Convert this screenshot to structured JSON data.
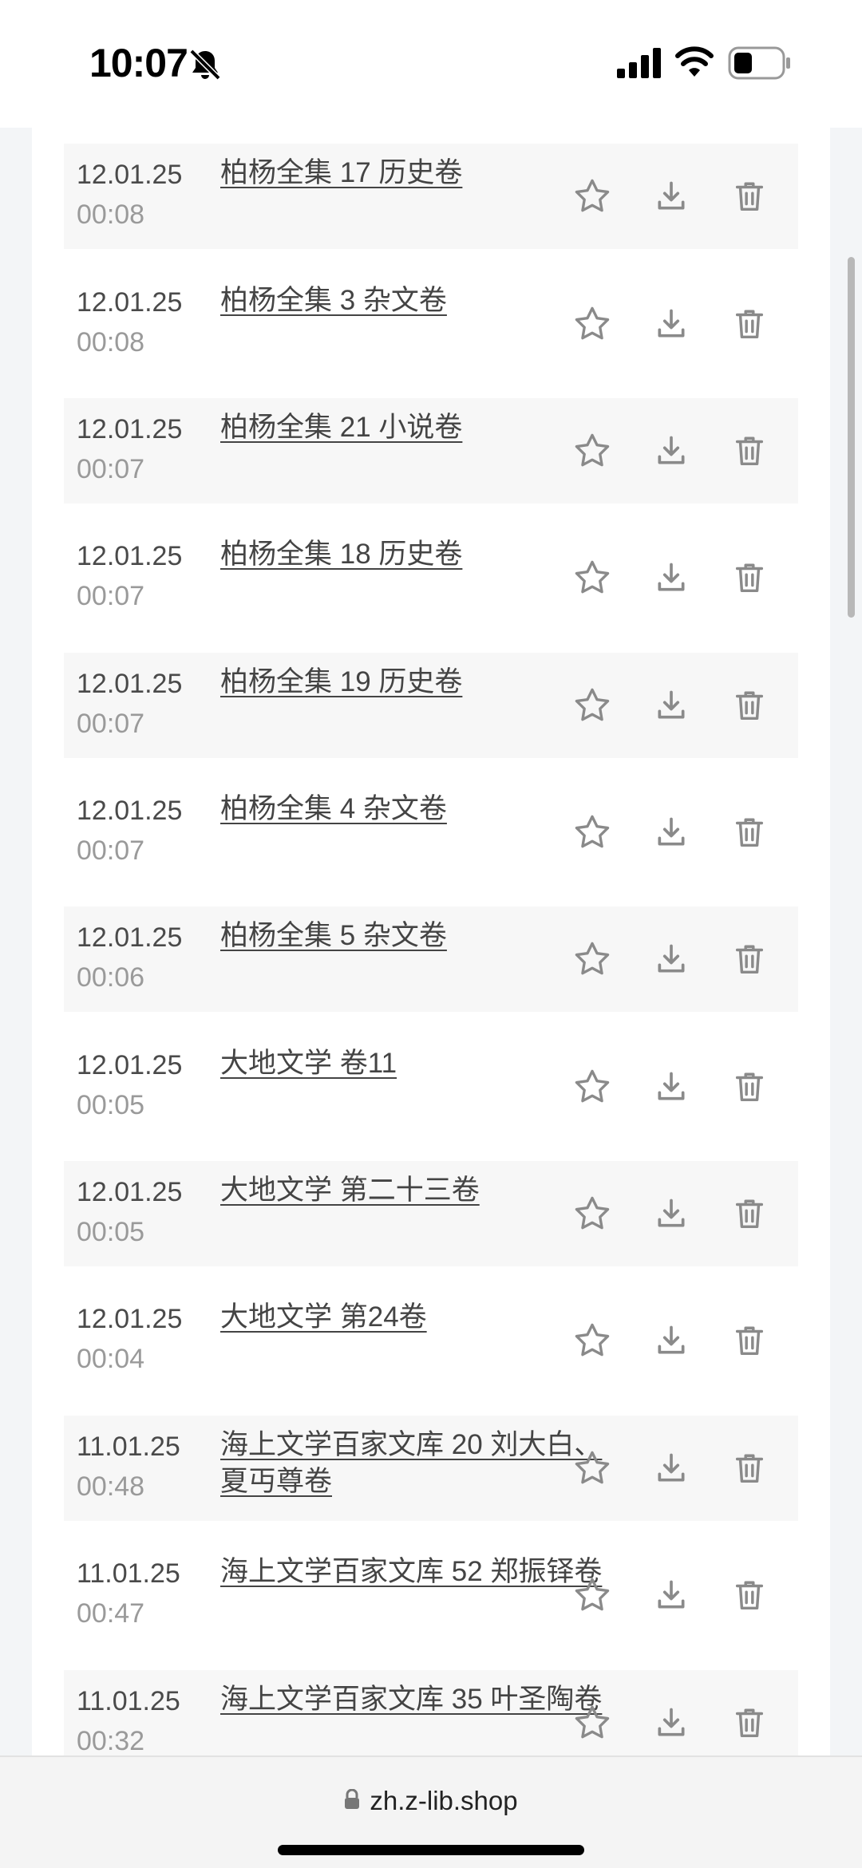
{
  "status_bar": {
    "time": "10:07",
    "icons": [
      "bell-slash-icon",
      "cellular-signal-icon",
      "wifi-icon",
      "battery-icon"
    ]
  },
  "rows": [
    {
      "date": "12.01.25",
      "time": "00:08",
      "title": "柏杨全集 17 历史卷"
    },
    {
      "date": "12.01.25",
      "time": "00:08",
      "title": "柏杨全集 3 杂文卷"
    },
    {
      "date": "12.01.25",
      "time": "00:07",
      "title": "柏杨全集 21 小说卷"
    },
    {
      "date": "12.01.25",
      "time": "00:07",
      "title": "柏杨全集 18 历史卷"
    },
    {
      "date": "12.01.25",
      "time": "00:07",
      "title": "柏杨全集 19 历史卷"
    },
    {
      "date": "12.01.25",
      "time": "00:07",
      "title": "柏杨全集 4 杂文卷"
    },
    {
      "date": "12.01.25",
      "time": "00:06",
      "title": "柏杨全集 5 杂文卷"
    },
    {
      "date": "12.01.25",
      "time": "00:05",
      "title": "大地文学 卷11"
    },
    {
      "date": "12.01.25",
      "time": "00:05",
      "title": "大地文学 第二十三卷"
    },
    {
      "date": "12.01.25",
      "time": "00:04",
      "title": "大地文学 第24卷"
    },
    {
      "date": "11.01.25",
      "time": "00:48",
      "title": "海上文学百家文库 20 刘大白、夏丏尊卷"
    },
    {
      "date": "11.01.25",
      "time": "00:47",
      "title": "海上文学百家文库 52 郑振铎卷"
    },
    {
      "date": "11.01.25",
      "time": "00:32",
      "title": "海上文学百家文库 35 叶圣陶卷"
    }
  ],
  "row_actions": [
    "star-icon",
    "download-icon",
    "trash-icon"
  ],
  "url_bar": {
    "url": "zh.z-lib.shop",
    "icon": "lock-icon"
  },
  "colors": {
    "icon_gray": "#8a8a8a",
    "row_shade": "#f7f7f7",
    "page_bg": "#f3f5f7"
  }
}
